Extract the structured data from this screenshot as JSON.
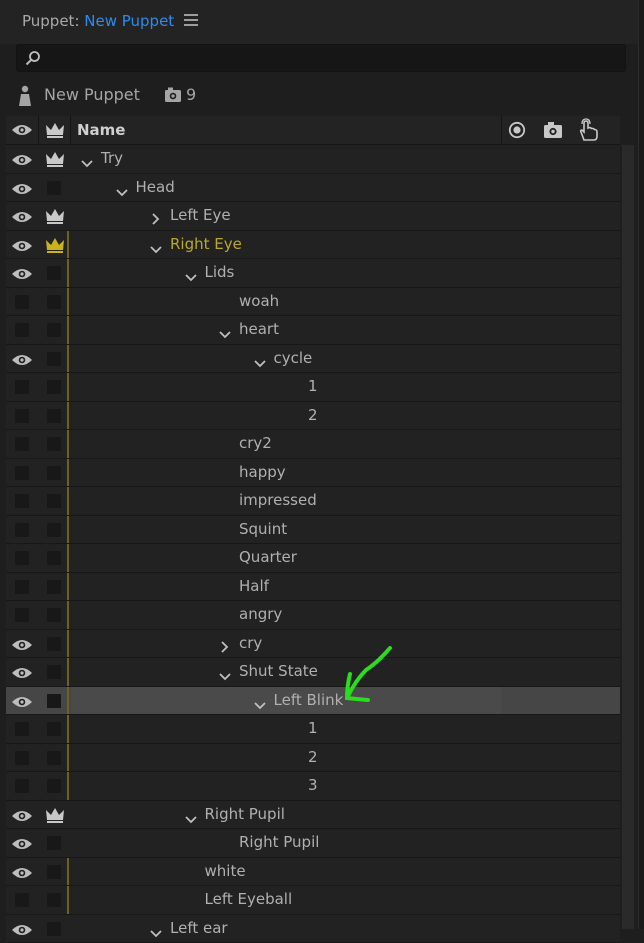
{
  "panel": {
    "prefix": "Puppet: ",
    "name": "New Puppet",
    "menu_icon": "hamburger-icon"
  },
  "search": {
    "value": "",
    "placeholder": "",
    "icon": "search-icon"
  },
  "puppet": {
    "name": "New Puppet",
    "rigging_count": "9"
  },
  "table": {
    "name_header": "Name",
    "tool_icons": [
      "record-icon",
      "camera-icon",
      "touch-icon"
    ]
  },
  "rows": [
    {
      "label": "Try",
      "depth": 0,
      "expander": "down",
      "eye": true,
      "crown": "white",
      "bar": false
    },
    {
      "label": "Head",
      "depth": 1,
      "expander": "down",
      "eye": true,
      "crown": "none",
      "bar": false
    },
    {
      "label": "Left Eye",
      "depth": 2,
      "expander": "right",
      "eye": true,
      "crown": "white",
      "bar": false
    },
    {
      "label": "Right Eye",
      "depth": 2,
      "expander": "down",
      "eye": true,
      "crown": "yellow",
      "bar": true,
      "highlight": true
    },
    {
      "label": "Lids",
      "depth": 3,
      "expander": "down",
      "eye": true,
      "crown": "none",
      "bar": true
    },
    {
      "label": "woah",
      "depth": 4,
      "expander": "none",
      "eye": false,
      "crown": "none",
      "bar": true
    },
    {
      "label": "heart",
      "depth": 4,
      "expander": "down",
      "eye": false,
      "crown": "none",
      "bar": true
    },
    {
      "label": "cycle",
      "depth": 5,
      "expander": "down",
      "eye": true,
      "crown": "none",
      "bar": true
    },
    {
      "label": "1",
      "depth": 6,
      "expander": "none",
      "eye": false,
      "crown": "none",
      "bar": true
    },
    {
      "label": "2",
      "depth": 6,
      "expander": "none",
      "eye": false,
      "crown": "none",
      "bar": true
    },
    {
      "label": "cry2",
      "depth": 4,
      "expander": "none",
      "eye": false,
      "crown": "none",
      "bar": true
    },
    {
      "label": "happy",
      "depth": 4,
      "expander": "none",
      "eye": false,
      "crown": "none",
      "bar": true
    },
    {
      "label": "impressed",
      "depth": 4,
      "expander": "none",
      "eye": false,
      "crown": "none",
      "bar": true
    },
    {
      "label": "Squint",
      "depth": 4,
      "expander": "none",
      "eye": false,
      "crown": "none",
      "bar": true
    },
    {
      "label": "Quarter",
      "depth": 4,
      "expander": "none",
      "eye": false,
      "crown": "none",
      "bar": true
    },
    {
      "label": "Half",
      "depth": 4,
      "expander": "none",
      "eye": false,
      "crown": "none",
      "bar": true
    },
    {
      "label": "angry",
      "depth": 4,
      "expander": "none",
      "eye": false,
      "crown": "none",
      "bar": true
    },
    {
      "label": "cry",
      "depth": 4,
      "expander": "right",
      "eye": true,
      "crown": "none",
      "bar": true
    },
    {
      "label": "Shut State",
      "depth": 4,
      "expander": "down",
      "eye": true,
      "crown": "none",
      "bar": true
    },
    {
      "label": "Left Blink",
      "depth": 5,
      "expander": "down",
      "eye": true,
      "crown": "none",
      "bar": true,
      "selected": true
    },
    {
      "label": "1",
      "depth": 6,
      "expander": "none",
      "eye": false,
      "crown": "none",
      "bar": true
    },
    {
      "label": "2",
      "depth": 6,
      "expander": "none",
      "eye": false,
      "crown": "none",
      "bar": true
    },
    {
      "label": "3",
      "depth": 6,
      "expander": "none",
      "eye": false,
      "crown": "none",
      "bar": true
    },
    {
      "label": "Right Pupil",
      "depth": 3,
      "expander": "down",
      "eye": true,
      "crown": "white",
      "bar": false
    },
    {
      "label": "Right Pupil",
      "depth": 4,
      "expander": "none",
      "eye": true,
      "crown": "none",
      "bar": false
    },
    {
      "label": "white",
      "depth": 3,
      "expander": "none",
      "eye": true,
      "crown": "none",
      "bar": true
    },
    {
      "label": "Left Eyeball",
      "depth": 3,
      "expander": "none",
      "eye": false,
      "crown": "none",
      "bar": true
    },
    {
      "label": "Left ear",
      "depth": 2,
      "expander": "down",
      "eye": true,
      "crown": "none",
      "bar": false
    }
  ],
  "colors": {
    "accent": "#2d8ceb",
    "highlight": "#b9a830",
    "crown_yellow": "#c9b21a",
    "annotation": "#2bdc1f"
  }
}
